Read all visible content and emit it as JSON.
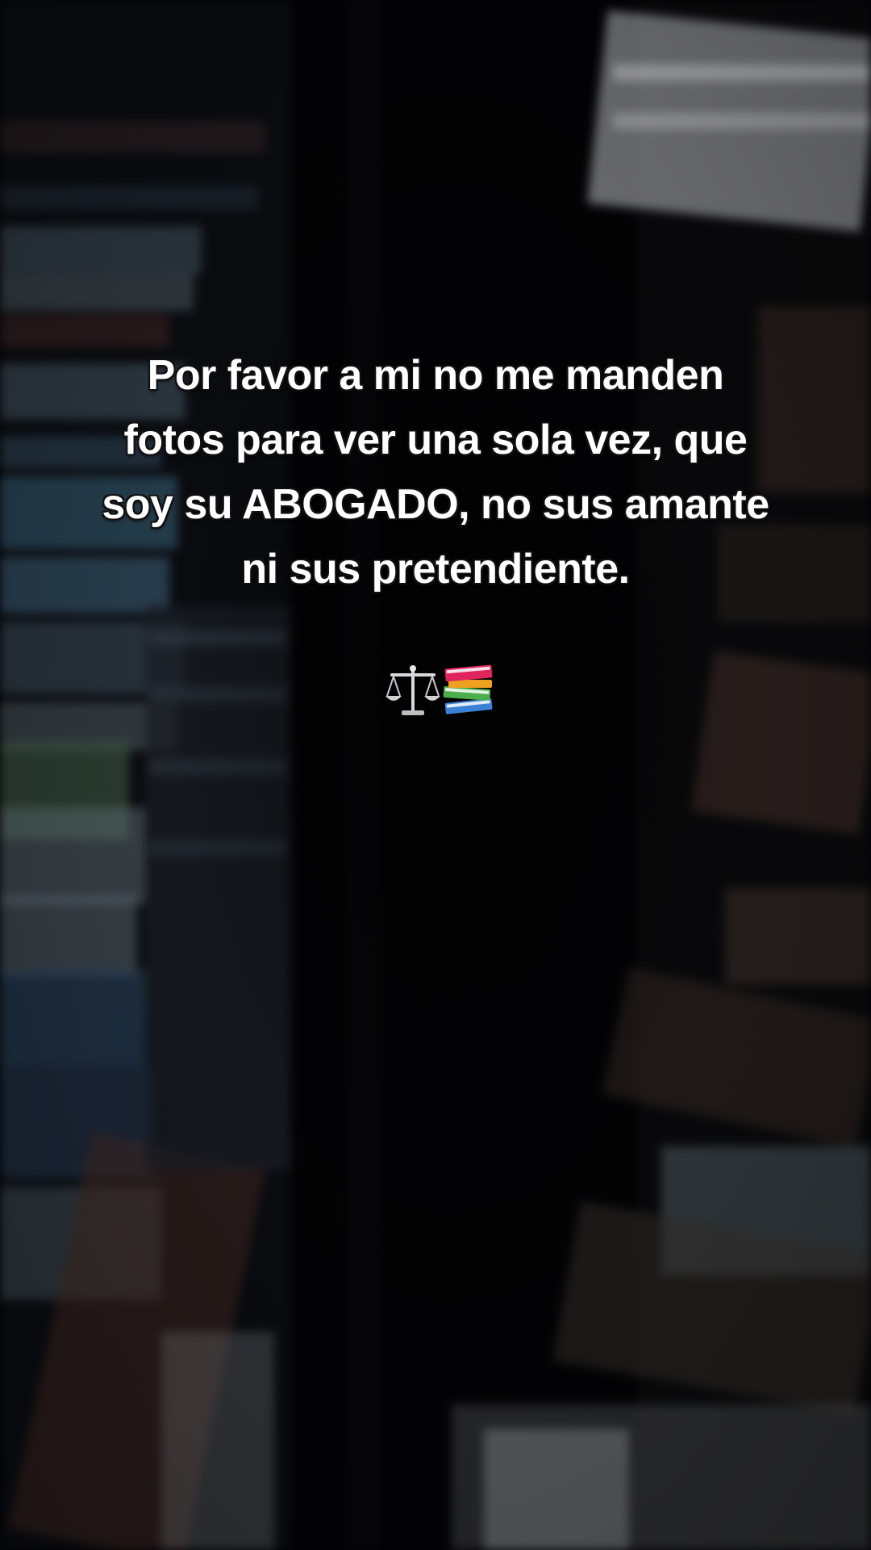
{
  "caption": {
    "lines": [
      "Por favor a mi no me manden",
      "fotos para ver una sola vez, que",
      "soy su ABOGADO, no sus amante",
      "ni sus pretendiente."
    ],
    "color": "#ffffff"
  },
  "emojis": [
    {
      "icon": "scales-icon"
    },
    {
      "icon": "books-icon"
    }
  ]
}
